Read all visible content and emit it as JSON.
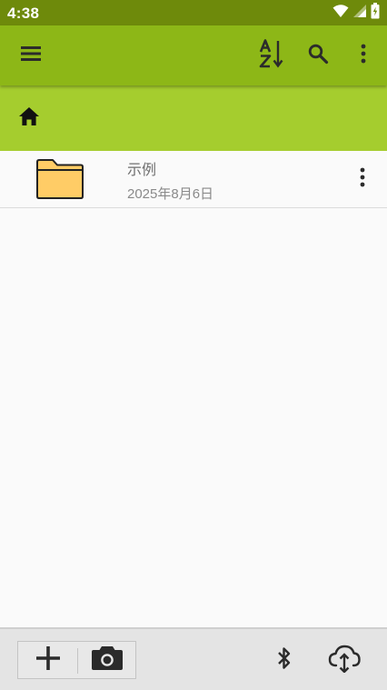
{
  "status_bar": {
    "time": "4:38",
    "icons": [
      "wifi-icon",
      "signal-icon",
      "battery-icon"
    ]
  },
  "toolbar": {
    "icons": [
      "menu-icon",
      "sort-az-icon",
      "search-icon",
      "more-vert-icon"
    ],
    "background": "#8db717"
  },
  "breadcrumb": {
    "icon": "home-icon",
    "background": "#a5cd2e"
  },
  "files": [
    {
      "icon": "folder-icon",
      "name": "示例",
      "date": "2025年8月6日"
    }
  ],
  "bottom_bar": {
    "icons": [
      "add-icon",
      "camera-icon",
      "bluetooth-icon",
      "cloud-sync-icon"
    ]
  },
  "colors": {
    "status_bar": "#6e8a0b",
    "folder_fill": "#ffcc66"
  }
}
